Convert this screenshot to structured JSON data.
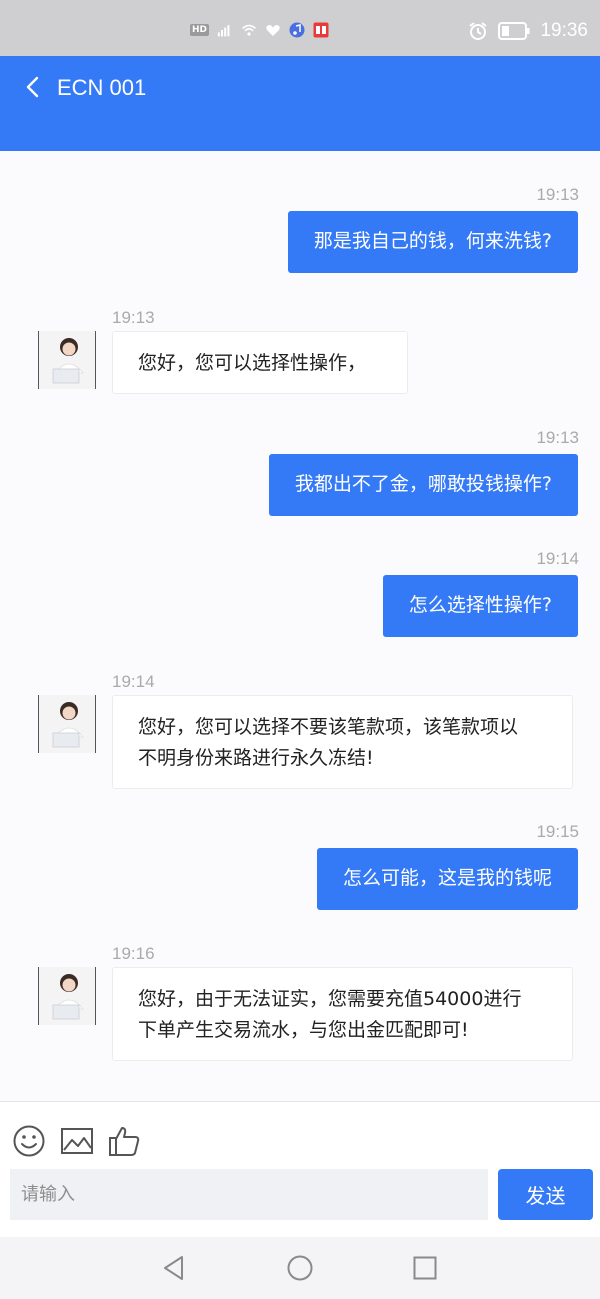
{
  "status_bar": {
    "network_label": "HD",
    "time": "19:36",
    "icons": [
      "hd-icon",
      "signal-5g-icon",
      "wifi-icon",
      "heart-app-icon",
      "music-app-icon",
      "book-app-icon",
      "alarm-icon",
      "battery-icon"
    ]
  },
  "header": {
    "title": "ECN 001",
    "back_icon": "chevron-left-icon",
    "color": "#3479f6"
  },
  "messages": [
    {
      "side": "out",
      "time": "19:13",
      "text": "那是我自己的钱，何来洗钱?"
    },
    {
      "side": "in",
      "time": "19:13",
      "text": "您好，您可以选择性操作，"
    },
    {
      "side": "out",
      "time": "19:13",
      "text": "我都出不了金，哪敢投钱操作?"
    },
    {
      "side": "out",
      "time": "19:14",
      "text": "怎么选择性操作?"
    },
    {
      "side": "in",
      "time": "19:14",
      "lines": [
        "您好，您可以选择不要该笔款项，该笔款项以",
        "不明身份来路进行永久冻结!"
      ]
    },
    {
      "side": "out",
      "time": "19:15",
      "text": "怎么可能，这是我的钱呢"
    },
    {
      "side": "in",
      "time": "19:16",
      "lines": [
        "您好，由于无法证实，您需要充值54000进行",
        "下单产生交易流水，与您出金匹配即可!"
      ]
    }
  ],
  "input_bar": {
    "tools": [
      "emoji-icon",
      "image-icon",
      "thumbs-up-icon"
    ],
    "placeholder": "请输入",
    "send_label": "发送"
  },
  "nav_bar": {
    "buttons": [
      "back-triangle-icon",
      "home-circle-icon",
      "recents-square-icon"
    ]
  }
}
